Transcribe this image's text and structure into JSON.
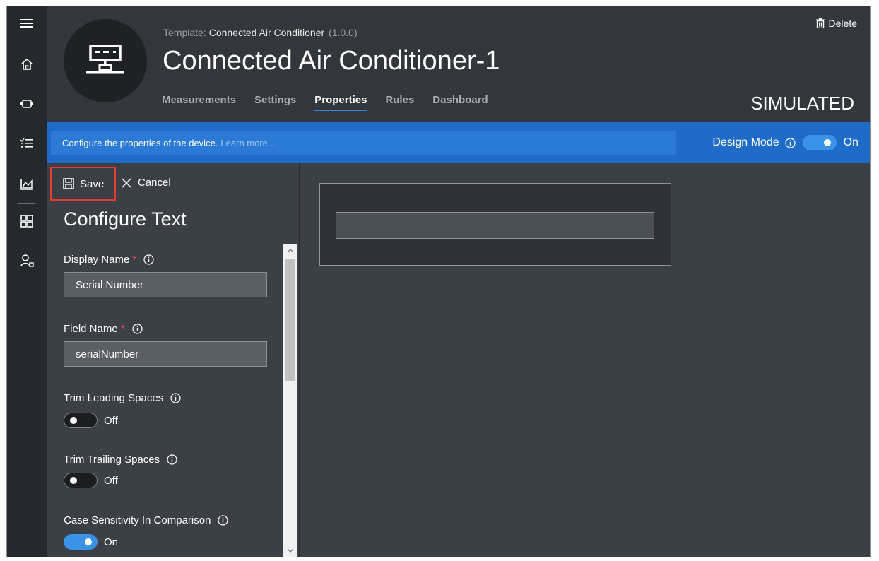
{
  "header": {
    "template_label": "Template:",
    "template_name": "Connected Air Conditioner",
    "template_version": "(1.0.0)",
    "title": "Connected Air Conditioner-1",
    "delete_label": "Delete",
    "status": "SIMULATED",
    "tabs": [
      {
        "label": "Measurements",
        "active": false
      },
      {
        "label": "Settings",
        "active": false
      },
      {
        "label": "Properties",
        "active": true
      },
      {
        "label": "Rules",
        "active": false
      },
      {
        "label": "Dashboard",
        "active": false
      }
    ]
  },
  "banner": {
    "message": "Configure the properties of the device.",
    "link": "Learn more...",
    "design_mode_label": "Design Mode",
    "design_mode_state": "On"
  },
  "panel": {
    "save_label": "Save",
    "cancel_label": "Cancel",
    "title": "Configure Text",
    "display_name_label": "Display Name",
    "display_name_value": "Serial Number",
    "field_name_label": "Field Name",
    "field_name_value": "serialNumber",
    "required_mark": "*",
    "trim_leading_label": "Trim Leading Spaces",
    "trim_leading_state": "Off",
    "trim_trailing_label": "Trim Trailing Spaces",
    "trim_trailing_state": "Off",
    "case_label": "Case Sensitivity In Comparison",
    "case_state": "On"
  },
  "rail": {
    "icons": [
      "hamburger-icon",
      "home-icon",
      "devices-icon",
      "checklist-icon",
      "analytics-icon",
      "dashboard-grid-icon",
      "users-icon"
    ]
  },
  "colors": {
    "accent": "#2f86e0",
    "banner": "#1f6cc8",
    "toggle_on": "#3b93e8",
    "save_highlight": "#e53b30"
  }
}
